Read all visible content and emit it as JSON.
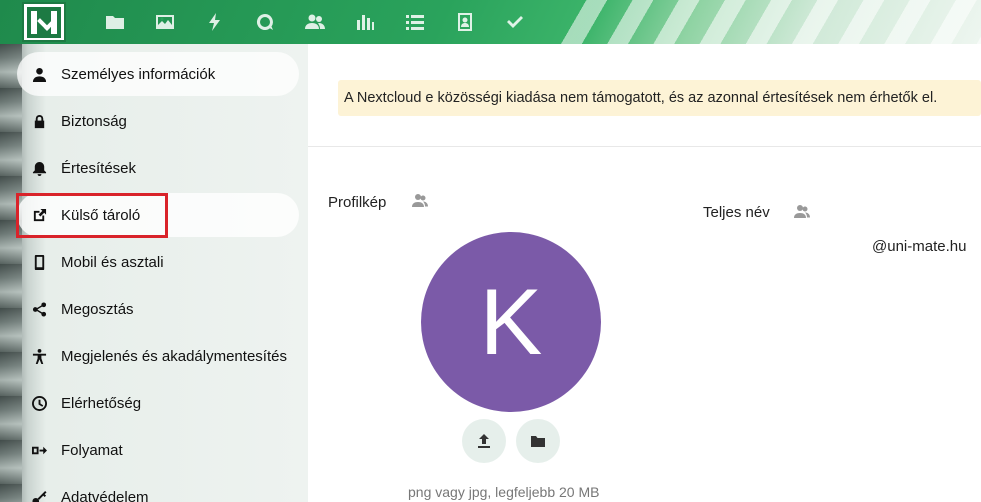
{
  "header": {
    "logo_icon": "mate-logo-icon",
    "apps": [
      {
        "name": "files",
        "icon": "folder-icon"
      },
      {
        "name": "photos",
        "icon": "image-icon"
      },
      {
        "name": "activity",
        "icon": "lightning-icon"
      },
      {
        "name": "talk",
        "icon": "search-bubble-icon"
      },
      {
        "name": "contacts",
        "icon": "users-icon"
      },
      {
        "name": "analytics",
        "icon": "bar-chart-icon"
      },
      {
        "name": "tasks",
        "icon": "list-icon"
      },
      {
        "name": "contacts-card",
        "icon": "contact-card-icon"
      },
      {
        "name": "check",
        "icon": "checkmark-icon"
      }
    ]
  },
  "sidebar": {
    "items": [
      {
        "label": "Személyes információk",
        "icon": "user-icon",
        "active": true
      },
      {
        "label": "Biztonság",
        "icon": "lock-icon"
      },
      {
        "label": "Értesítések",
        "icon": "bell-icon"
      },
      {
        "label": "Külső tároló",
        "icon": "external-link-icon",
        "hover": true
      },
      {
        "label": "Mobil és asztali",
        "icon": "phone-icon"
      },
      {
        "label": "Megosztás",
        "icon": "share-icon"
      },
      {
        "label": "Megjelenés és akadálymentesítés",
        "icon": "accessibility-icon"
      },
      {
        "label": "Elérhetőség",
        "icon": "clock-icon"
      },
      {
        "label": "Folyamat",
        "icon": "flow-icon"
      },
      {
        "label": "Adatvédelem",
        "icon": "key-icon"
      }
    ]
  },
  "main": {
    "warning": "A Nextcloud e közösségi kiadása nem támogatott, és az azonnal értesítések nem érhetők el.",
    "profile_label": "Profilkép",
    "fullname_label": "Teljes név",
    "email_value": "@uni-mate.hu",
    "avatar_initial": "K",
    "avatar_color": "#7b5aa8",
    "upload_hint": "png vagy jpg, legfeljebb 20 MB"
  },
  "colors": {
    "accent": "#2aa35c",
    "highlight": "#d9232a",
    "warning_bg": "#fdf3d6"
  }
}
